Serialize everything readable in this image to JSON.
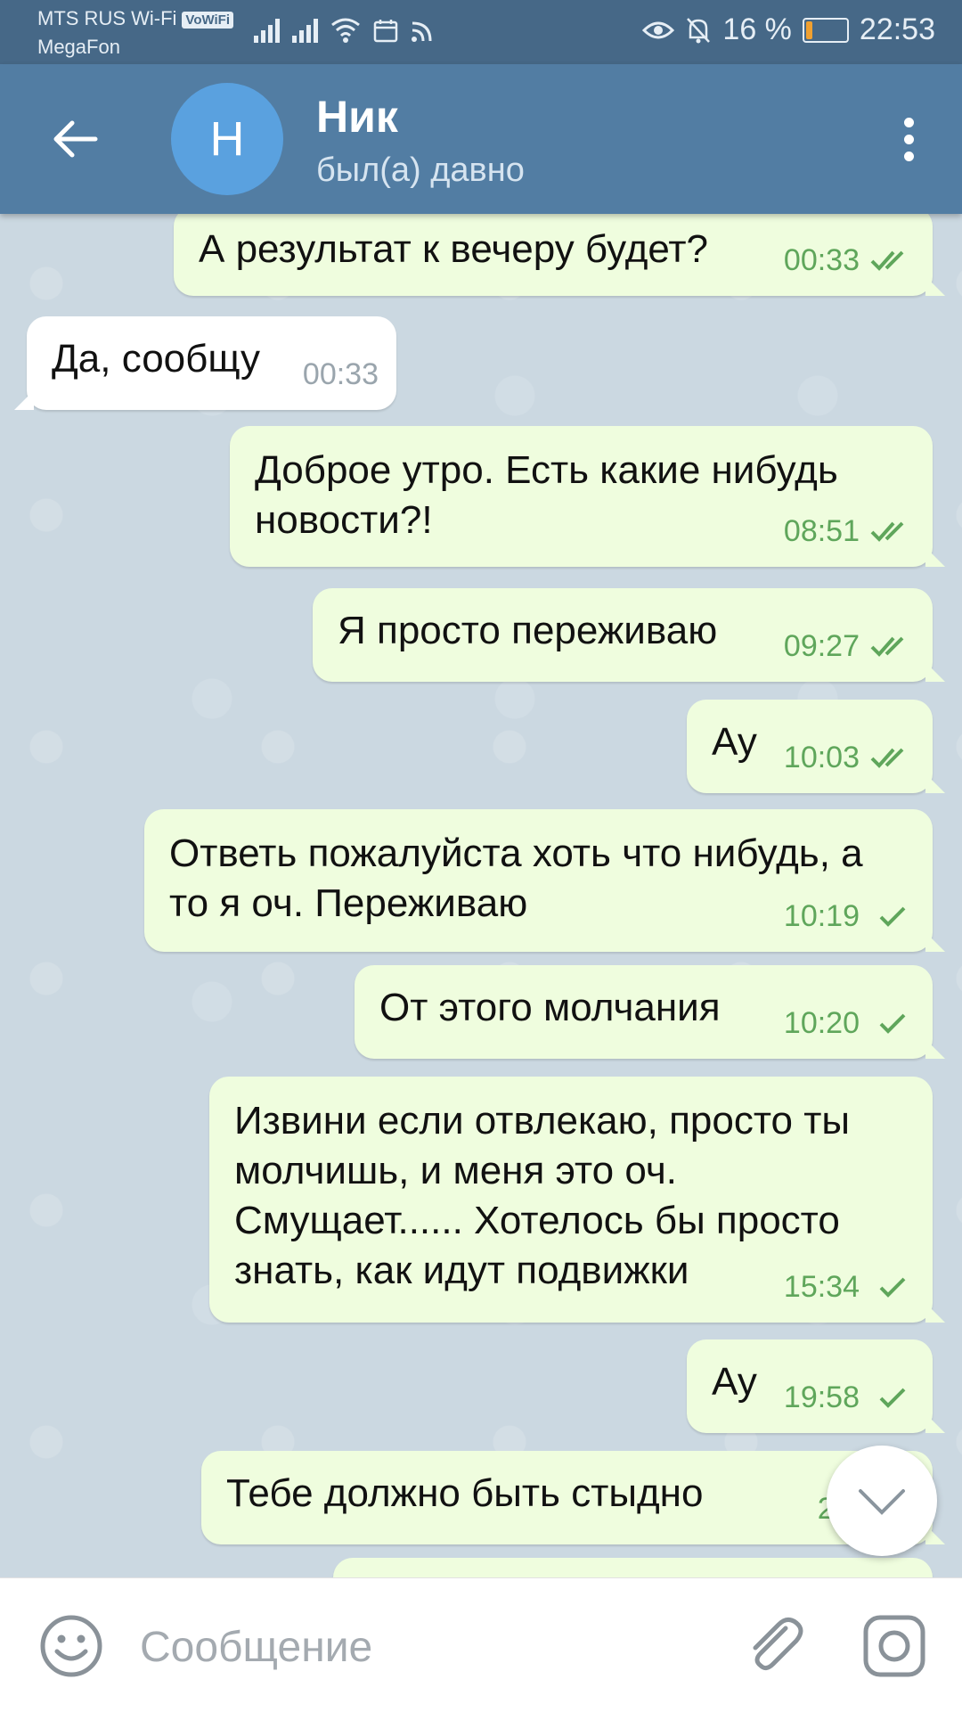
{
  "status_bar": {
    "carrier_line1": "MTS RUS Wi-Fi",
    "volte_badge": "VoWiFi",
    "carrier_line2": "MegaFon",
    "battery_text": "16 %",
    "battery_level": 0.16,
    "time": "22:53",
    "icons": [
      "signal-icon",
      "signal-icon",
      "wifi-icon",
      "calendar-icon",
      "rss-icon",
      "eye-icon",
      "bell-off-icon",
      "battery-icon"
    ]
  },
  "header": {
    "avatar_letter": "Н",
    "contact_name": "Ник",
    "contact_status": "был(а) давно",
    "colors": {
      "appbar": "#527da3",
      "avatar": "#5aa1df"
    }
  },
  "messages": [
    {
      "dir": "out",
      "text": "А результат к вечеру будет?",
      "time": "00:33",
      "read": true
    },
    {
      "dir": "in",
      "text": "Да, сообщу",
      "time": "00:33"
    },
    {
      "dir": "out",
      "text": "Доброе утро. Есть какие нибудь новости?!",
      "time": "08:51",
      "read": true
    },
    {
      "dir": "out",
      "text": "Я просто переживаю",
      "time": "09:27",
      "read": true
    },
    {
      "dir": "out",
      "text": "Ау",
      "time": "10:03",
      "read": true
    },
    {
      "dir": "out",
      "text": "Ответь пожалуйста хоть что нибудь, а то я оч. Переживаю",
      "time": "10:19",
      "read": false
    },
    {
      "dir": "out",
      "text": "От этого молчания",
      "time": "10:20",
      "read": false
    },
    {
      "dir": "out",
      "text": "Извини если отвлекаю, просто ты молчишь, и меня это оч. Смущает...... Хотелось бы просто знать, как идут подвижки",
      "time": "15:34",
      "read": false
    },
    {
      "dir": "out",
      "text": "Ау",
      "time": "19:58",
      "read": false
    },
    {
      "dir": "out",
      "text": "Тебе должно быть стыдно",
      "time": "22:",
      "read": false
    }
  ],
  "input": {
    "placeholder": "Сообщение",
    "value": ""
  },
  "colors": {
    "outgoing_bubble": "#effdde",
    "incoming_bubble": "#ffffff",
    "check_color": "#5fa65b"
  }
}
